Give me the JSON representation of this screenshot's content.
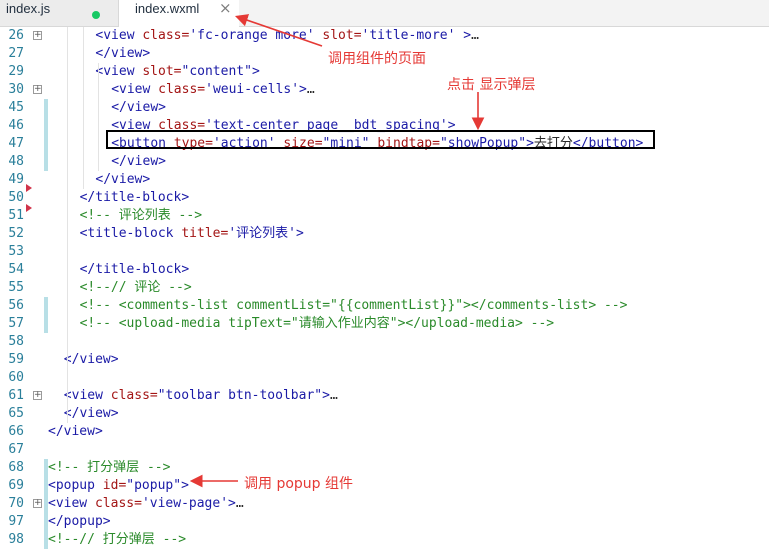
{
  "tabs": [
    {
      "label": "index.js",
      "modified": true
    },
    {
      "label": "index.wxml",
      "active": true,
      "close": "×"
    }
  ],
  "annotations": {
    "page_caller": "调用组件的页面",
    "click_show": "点击  显示弹层",
    "call_popup": "调用  popup 组件"
  },
  "colors": {
    "annotation": "#e53935",
    "gutter_bar": "#b8dfe6",
    "tag": "#1a1aa6",
    "attribute": "#a31515",
    "comment": "#2a8a2a"
  },
  "lines": [
    {
      "n": "26",
      "fold": true,
      "indent": 6,
      "tokens": [
        [
          "tag",
          "<view "
        ],
        [
          "attr",
          "class="
        ],
        [
          "str",
          "'fc-orange more' "
        ],
        [
          "attr",
          "slot="
        ],
        [
          "str",
          "'title-more' "
        ],
        [
          "tag",
          ">"
        ],
        [
          "txt",
          "…"
        ]
      ]
    },
    {
      "n": "27",
      "fold": false,
      "indent": 6,
      "tokens": [
        [
          "tag",
          "</view>"
        ]
      ]
    },
    {
      "n": "29",
      "fold": false,
      "indent": 6,
      "tokens": [
        [
          "tag",
          "<view "
        ],
        [
          "attr",
          "slot="
        ],
        [
          "str",
          "\"content\""
        ],
        [
          "tag",
          ">"
        ]
      ]
    },
    {
      "n": "30",
      "fold": true,
      "indent": 8,
      "tokens": [
        [
          "tag",
          "<view "
        ],
        [
          "attr",
          "class="
        ],
        [
          "str",
          "'weui-cells'"
        ],
        [
          "tag",
          ">"
        ],
        [
          "txt",
          "…"
        ]
      ]
    },
    {
      "n": "45",
      "fold": false,
      "indent": 8,
      "tokens": [
        [
          "tag",
          "</view>"
        ]
      ]
    },
    {
      "n": "46",
      "fold": false,
      "indent": 8,
      "tokens": [
        [
          "tag",
          "<view "
        ],
        [
          "attr",
          "class="
        ],
        [
          "str",
          "'text-center page__bdt_spacing'"
        ],
        [
          "tag",
          ">"
        ]
      ]
    },
    {
      "n": "47",
      "fold": false,
      "indent": 8,
      "tokens": [
        [
          "tag",
          "<button "
        ],
        [
          "attr",
          "type="
        ],
        [
          "str",
          "'action' "
        ],
        [
          "attr",
          "size="
        ],
        [
          "str",
          "\"mini\" "
        ],
        [
          "attr",
          "bindtap="
        ],
        [
          "str",
          "\"showPopup\""
        ],
        [
          "tag",
          ">"
        ],
        [
          "txt",
          "去打分"
        ],
        [
          "tag",
          "</button>"
        ]
      ]
    },
    {
      "n": "48",
      "fold": false,
      "indent": 8,
      "tokens": [
        [
          "tag",
          "</view>"
        ]
      ]
    },
    {
      "n": "49",
      "fold": false,
      "indent": 6,
      "tokens": [
        [
          "tag",
          "</view>"
        ]
      ]
    },
    {
      "n": "50",
      "fold": false,
      "indent": 4,
      "tokens": [
        [
          "tag",
          "</title-block>"
        ]
      ]
    },
    {
      "n": "51",
      "fold": false,
      "indent": 4,
      "tokens": [
        [
          "cmt",
          "<!-- 评论列表 -->"
        ]
      ]
    },
    {
      "n": "52",
      "fold": false,
      "indent": 4,
      "tokens": [
        [
          "tag",
          "<title-block "
        ],
        [
          "attr",
          "title="
        ],
        [
          "str",
          "'评论列表'"
        ],
        [
          "tag",
          ">"
        ]
      ]
    },
    {
      "n": "53",
      "fold": false,
      "indent": 0,
      "tokens": []
    },
    {
      "n": "54",
      "fold": false,
      "indent": 4,
      "tokens": [
        [
          "tag",
          "</title-block>"
        ]
      ]
    },
    {
      "n": "55",
      "fold": false,
      "indent": 4,
      "tokens": [
        [
          "cmt",
          "<!--// 评论 -->"
        ]
      ]
    },
    {
      "n": "56",
      "fold": false,
      "indent": 4,
      "tokens": [
        [
          "cmt",
          "<!-- <comments-list commentList=\"{{commentList}}\"></comments-list> -->"
        ]
      ]
    },
    {
      "n": "57",
      "fold": false,
      "indent": 4,
      "tokens": [
        [
          "cmt",
          "<!-- <upload-media tipText=\"请输入作业内容\"></upload-media> -->"
        ]
      ]
    },
    {
      "n": "58",
      "fold": false,
      "indent": 0,
      "tokens": []
    },
    {
      "n": "59",
      "fold": false,
      "indent": 2,
      "tokens": [
        [
          "tag",
          "</view>"
        ]
      ]
    },
    {
      "n": "60",
      "fold": false,
      "indent": 0,
      "tokens": []
    },
    {
      "n": "61",
      "fold": true,
      "indent": 2,
      "tokens": [
        [
          "tag",
          "<view "
        ],
        [
          "attr",
          "class="
        ],
        [
          "str",
          "\"toolbar btn-toolbar\""
        ],
        [
          "tag",
          ">"
        ],
        [
          "txt",
          "…"
        ]
      ]
    },
    {
      "n": "65",
      "fold": false,
      "indent": 2,
      "tokens": [
        [
          "tag",
          "</view>"
        ]
      ]
    },
    {
      "n": "66",
      "fold": false,
      "indent": 0,
      "tokens": [
        [
          "tag",
          "</view>"
        ]
      ]
    },
    {
      "n": "67",
      "fold": false,
      "indent": 0,
      "tokens": []
    },
    {
      "n": "68",
      "fold": false,
      "indent": 0,
      "tokens": [
        [
          "cmt",
          "<!-- 打分弹层 -->"
        ]
      ]
    },
    {
      "n": "69",
      "fold": false,
      "indent": 0,
      "tokens": [
        [
          "tag",
          "<popup "
        ],
        [
          "attr",
          "id="
        ],
        [
          "str",
          "\"popup\""
        ],
        [
          "tag",
          ">"
        ]
      ]
    },
    {
      "n": "70",
      "fold": true,
      "indent": 0,
      "tokens": [
        [
          "tag",
          "<view "
        ],
        [
          "attr",
          "class="
        ],
        [
          "str",
          "'view-page'"
        ],
        [
          "tag",
          ">"
        ],
        [
          "txt",
          "…"
        ]
      ]
    },
    {
      "n": "97",
      "fold": false,
      "indent": 0,
      "tokens": [
        [
          "tag",
          "</popup>"
        ]
      ]
    },
    {
      "n": "98",
      "fold": false,
      "indent": 0,
      "tokens": [
        [
          "cmt",
          "<!--// 打分弹层 -->"
        ]
      ]
    }
  ]
}
